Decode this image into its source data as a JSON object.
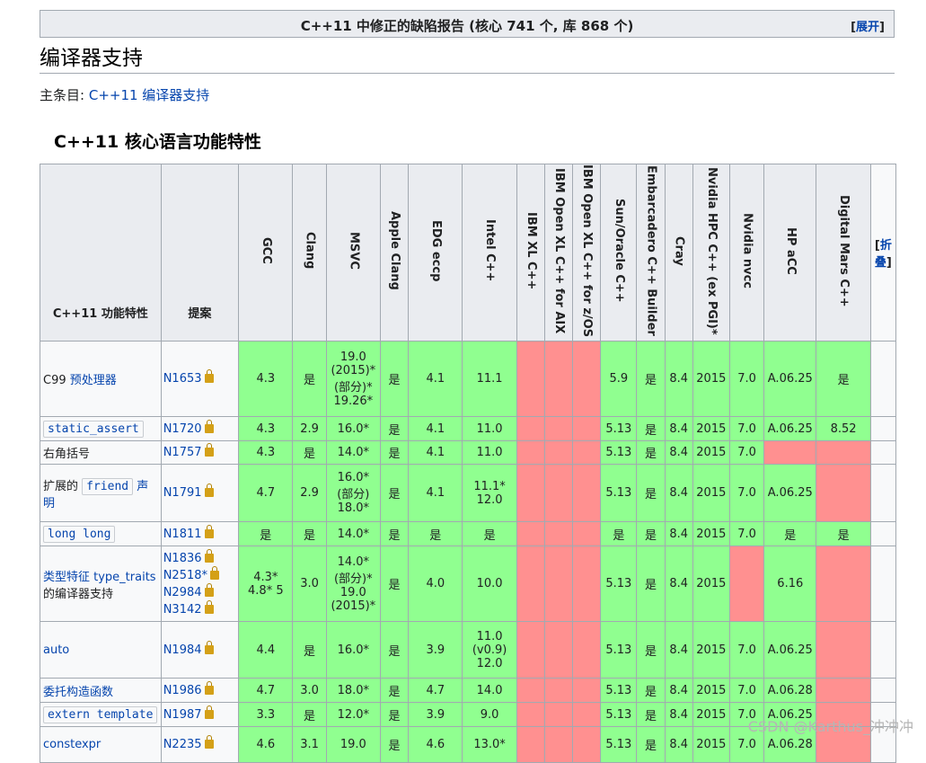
{
  "collapse_box": {
    "title": "C++11 中修正的缺陷报告 (核心 741 个, 库 868 个)",
    "toggle_label": "展开"
  },
  "section_title": "编译器支持",
  "hatnote": {
    "prefix": "主条目:",
    "link": "C++11 编译器支持"
  },
  "subsection_title": "C++11 核心语言功能特性",
  "table": {
    "header_feature": "C++11 功能特性",
    "header_proposal": "提案",
    "compilers": [
      "GCC",
      "Clang",
      "MSVC",
      "Apple Clang",
      "EDG eccp",
      "Intel C++",
      "IBM XL C++",
      "IBM Open XL C++ for AIX",
      "IBM Open XL C++ for z/OS",
      "Sun/Oracle C++",
      "Embarcadero C++ Builder",
      "Cray",
      "Nvidia HPC C++ (ex PGI)*",
      "Nvidia nvcc",
      "HP aCC",
      "Digital Mars C++"
    ],
    "fold_label": "折叠",
    "rows": [
      {
        "feature": [
          {
            "t": "C99 ",
            "s": "plain"
          },
          {
            "t": "预处理器",
            "s": "link"
          }
        ],
        "proposals": [
          "N1653"
        ],
        "cells": [
          "4.3",
          "是",
          "19.0 (2015)* (部分)* 19.26*",
          "是",
          "4.1",
          "11.1",
          "",
          "",
          "",
          "5.9",
          "是",
          "8.4",
          "2015",
          "7.0",
          "A.06.25",
          "是"
        ]
      },
      {
        "feature": [
          {
            "t": "static_assert",
            "s": "code"
          }
        ],
        "proposals": [
          "N1720"
        ],
        "cells": [
          "4.3",
          "2.9",
          "16.0*",
          "是",
          "4.1",
          "11.0",
          "",
          "",
          "",
          "5.13",
          "是",
          "8.4",
          "2015",
          "7.0",
          "A.06.25",
          "8.52"
        ]
      },
      {
        "feature": [
          {
            "t": "右角括号",
            "s": "plain"
          }
        ],
        "proposals": [
          "N1757"
        ],
        "cells": [
          "4.3",
          "是",
          "14.0*",
          "是",
          "4.1",
          "11.0",
          "",
          "",
          "",
          "5.13",
          "是",
          "8.4",
          "2015",
          "7.0",
          "",
          ""
        ]
      },
      {
        "feature": [
          {
            "t": "扩展的 ",
            "s": "plain"
          },
          {
            "t": "friend",
            "s": "code"
          },
          {
            "t": " 声明",
            "s": "link"
          }
        ],
        "proposals": [
          "N1791"
        ],
        "cells": [
          "4.7",
          "2.9",
          "16.0* (部分) 18.0*",
          "是",
          "4.1",
          "11.1* 12.0",
          "",
          "",
          "",
          "5.13",
          "是",
          "8.4",
          "2015",
          "7.0",
          "A.06.25",
          ""
        ]
      },
      {
        "feature": [
          {
            "t": "long long",
            "s": "code"
          }
        ],
        "proposals": [
          "N1811"
        ],
        "cells": [
          "是",
          "是",
          "14.0*",
          "是",
          "是",
          "是",
          "",
          "",
          "",
          "是",
          "是",
          "8.4",
          "2015",
          "7.0",
          "是",
          "是"
        ]
      },
      {
        "feature": [
          {
            "t": "类型特征 type_traits",
            "s": "link"
          },
          {
            "t": " 的编译器支持",
            "s": "plain"
          }
        ],
        "proposals": [
          "N1836",
          "N2518*",
          "N2984",
          "N3142"
        ],
        "cells": [
          "4.3* 4.8* 5",
          "3.0",
          "14.0* (部分)* 19.0 (2015)*",
          "是",
          "4.0",
          "10.0",
          "",
          "",
          "",
          "5.13",
          "是",
          "8.4",
          "2015",
          "",
          "6.16",
          ""
        ]
      },
      {
        "feature": [
          {
            "t": "auto",
            "s": "link"
          }
        ],
        "proposals": [
          "N1984"
        ],
        "cells": [
          "4.4",
          "是",
          "16.0*",
          "是",
          "3.9",
          "11.0 (v0.9) 12.0",
          "",
          "",
          "",
          "5.13",
          "是",
          "8.4",
          "2015",
          "7.0",
          "A.06.25",
          ""
        ]
      },
      {
        "feature": [
          {
            "t": "委托构造函数",
            "s": "link"
          }
        ],
        "proposals": [
          "N1986"
        ],
        "cells": [
          "4.7",
          "3.0",
          "18.0*",
          "是",
          "4.7",
          "14.0",
          "",
          "",
          "",
          "5.13",
          "是",
          "8.4",
          "2015",
          "7.0",
          "A.06.28",
          ""
        ]
      },
      {
        "feature": [
          {
            "t": "extern template",
            "s": "code"
          }
        ],
        "proposals": [
          "N1987"
        ],
        "cells": [
          "3.3",
          "是",
          "12.0*",
          "是",
          "3.9",
          "9.0",
          "",
          "",
          "",
          "5.13",
          "是",
          "8.4",
          "2015",
          "7.0",
          "A.06.25",
          ""
        ]
      },
      {
        "feature": [
          {
            "t": "constexpr",
            "s": "link"
          }
        ],
        "proposals": [
          "N2235"
        ],
        "cells": [
          "4.6",
          "3.1",
          "19.0",
          "是",
          "4.6",
          "13.0*",
          "",
          "",
          "",
          "5.13",
          "是",
          "8.4",
          "2015",
          "7.0",
          "A.06.28",
          ""
        ]
      }
    ]
  },
  "watermark": "CSDN @Karthus_冲冲冲",
  "colors": {
    "supported": "#90ff90",
    "unsupported": "#ff9090",
    "header": "#eaecf0",
    "link": "#0645ad"
  }
}
